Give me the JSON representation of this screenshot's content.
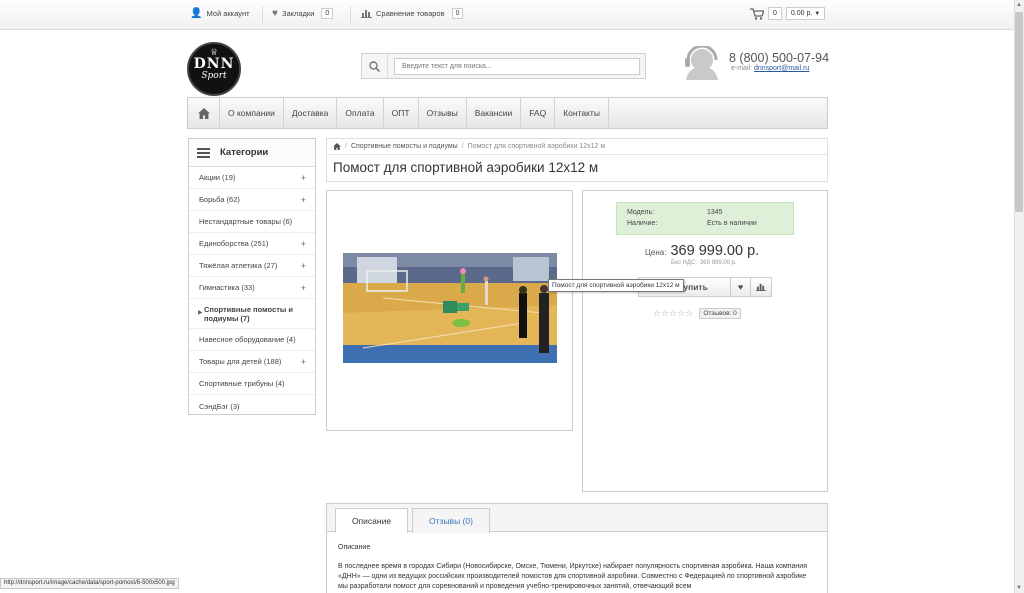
{
  "topbar": {
    "account_label": "Мой аккаунт",
    "bookmarks_label": "Закладки",
    "bookmarks_count": "0",
    "compare_label": "Сравнение товаров",
    "compare_count": "0",
    "cart_count": "0",
    "cart_total": "0.00 р."
  },
  "logo": {
    "line1": "DNN",
    "line2": "Sport"
  },
  "search": {
    "placeholder": "Введите текст для поиска..."
  },
  "contacts": {
    "phone": "8 (800) 500-07-94",
    "email_label": "e-mail:",
    "email": "dnnsport@mail.ru"
  },
  "menu": {
    "items": [
      "О компании",
      "Доставка",
      "Оплата",
      "ОПТ",
      "Отзывы",
      "Вакансии",
      "FAQ",
      "Контакты"
    ]
  },
  "sidebar": {
    "title": "Категории",
    "items": [
      {
        "label": "Акции (19)",
        "expand": "+"
      },
      {
        "label": "Борьба (62)",
        "expand": "+"
      },
      {
        "label": "Нестандартные товары (6)",
        "expand": ""
      },
      {
        "label": "Единоборства (251)",
        "expand": "+"
      },
      {
        "label": "Тяжёлая атлетика (27)",
        "expand": "+"
      },
      {
        "label": "Гимнастика (33)",
        "expand": "+"
      },
      {
        "label": "Спортивные помосты и подиумы (7)",
        "expand": ""
      },
      {
        "label": "Навесное оборудование (4)",
        "expand": ""
      },
      {
        "label": "Товары для детей (188)",
        "expand": "+"
      },
      {
        "label": "Спортивные трибуны (4)",
        "expand": ""
      },
      {
        "label": "СэндБэг (3)",
        "expand": ""
      }
    ]
  },
  "breadcrumb": {
    "category": "Спортивные помосты и подиумы",
    "sep": "/",
    "current": "Помост для спортивной аэробики 12x12 м"
  },
  "product": {
    "title": "Помост для спортивной аэробики 12x12 м",
    "model_label": "Модель:",
    "model_value": "1345",
    "availability_label": "Наличие:",
    "availability_value": "Есть в наличии",
    "price_label": "Цена:",
    "price": "369 999.00 р.",
    "tax_label": "Без НДС:",
    "tax_value": "369 999.00 р.",
    "buy_label": "Купить",
    "tooltip": "Помост для спортивной аэробики 12x12 м",
    "reviews_label": "Отзывов: 0",
    "rating": 0,
    "rating_max": 5
  },
  "tabs": {
    "description_tab": "Описание",
    "reviews_tab": "Отзывы (0)",
    "description_title": "Описание",
    "description_text": "В последнее время в городах Сибири (Новосибирске, Омске, Тюмени, Иркутске) набирает популярность спортивная аэробика. Наша компания «ДНН» — одни из ведущих российских производителей помостов для спортивной аэробики. Совместно с Федерацией по спортивной аэробике мы разработали помост для соревнований и проведения учебно-тренировочных занятий, отвечающий всем"
  },
  "statusbar": {
    "url": "http://dnnsport.ru/image/cache/data/sport-pomost/6-500x500.jpg"
  }
}
